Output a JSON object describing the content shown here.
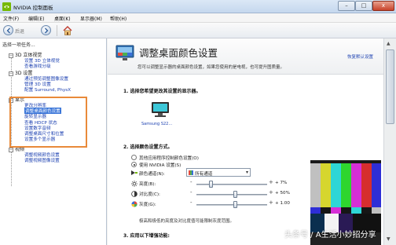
{
  "window": {
    "title": "NVIDIA 控制面板"
  },
  "window_buttons": {
    "minimize": "–",
    "maximize": "□",
    "close": "x"
  },
  "menu": [
    "文件(F)",
    "编辑(E)",
    "桌面(K)",
    "显示器(M)",
    "帮助(H)"
  ],
  "toolbar": {
    "back_label": "后退",
    "back_icon": "back-arrow-icon",
    "forward_icon": "forward-arrow-icon",
    "home_icon": "home-icon"
  },
  "sidebar": {
    "title": "选择一项任务...",
    "groups": [
      {
        "label": "3D 立体视觉",
        "expander": "−",
        "items": [
          "设置 3D 立体视觉",
          "查看游戏分级"
        ]
      },
      {
        "label": "3D 设置",
        "expander": "−",
        "items": [
          "通过预览调整图像设置",
          "管理 3D 设置",
          "配置 Surround, PhysX"
        ]
      },
      {
        "label": "显示",
        "expander": "−",
        "items": [
          "更改分辨率",
          "调整桌面颜色设置",
          "旋转显示器",
          "查看 HDCP 状态",
          "设置数字音频",
          "调整桌面尺寸和位置",
          "设置多个显示器"
        ],
        "selected_index": 1
      },
      {
        "label": "视频",
        "expander": "−",
        "items": [
          "调整视频颜色设置",
          "调整视频图像设置"
        ]
      }
    ]
  },
  "content": {
    "title": "调整桌面颜色设置",
    "restore_link": "恢复默认设置",
    "description": "您可以调整显示器的桌面颜色设置，如果您使用的是电视，也可提升图质量。",
    "section1": {
      "title": "1.  选择您希望更改其设置的显示器。",
      "monitor_label": "Samsung S22..."
    },
    "section2": {
      "title": "2.  选择颜色设置方式。",
      "radio_other": "其他应用程序控制颜色设置(O)",
      "radio_nvidia": "使用 NVIDIA 设置(S)",
      "selected_radio": "nvidia",
      "channel_label": "颜色通道(N):",
      "channel_value": "所有通道",
      "sliders": [
        {
          "label": "亮度(B):",
          "value": "+ 7%",
          "position": 0.2
        },
        {
          "label": "对比度(C):",
          "value": "+ 50%",
          "position": 0.55
        },
        {
          "label": "灰度(G):",
          "value": "+ 1.00",
          "position": 0.55
        }
      ],
      "note": "极高和极低的亮度及对比度值可能限制灰度范围。"
    },
    "section3": {
      "title": "3.  应用以下增强功能:"
    }
  },
  "scrollbar": {
    "up": "▲",
    "down": "▼"
  },
  "watermark": "头条号 / A生活小妙招分享",
  "colors": {
    "accent_orange": "#e98a3a",
    "selection_blue": "#3874d8",
    "link_blue": "#1a3fb0",
    "nvidia_green": "#76b900"
  }
}
